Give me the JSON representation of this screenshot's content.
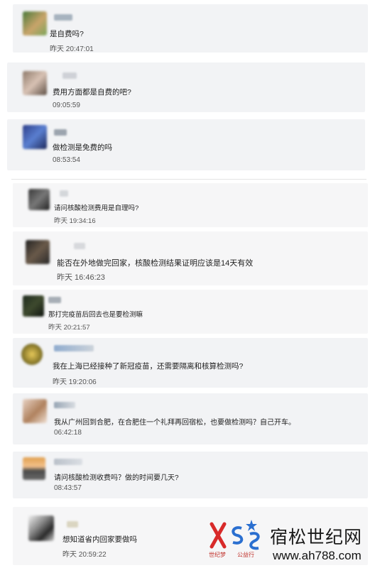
{
  "comments": [
    {
      "message": "是自费吗?",
      "time": "昨天 20:47:01"
    },
    {
      "message": "费用方面都是自费的吧?",
      "time": "09:05:59"
    },
    {
      "message": "做检测是免费的吗",
      "time": "08:53:54"
    },
    {
      "message": "请问核酸检测费用是自理吗?",
      "time": "昨天 19:34:16"
    },
    {
      "message": "能否在外地做完回家，核酸检测结果证明应该是14天有效",
      "time": "昨天 16:46:23"
    },
    {
      "message": "那打完疫苗后回去也是要检测嘛",
      "time": "昨天 20:21:57"
    },
    {
      "message": "我在上海已经接种了新冠疫苗，还需要隔离和核算检测吗?",
      "time": "昨天 19:20:06"
    },
    {
      "message": "我从广州回到合肥，在合肥住一个礼拜再回宿松，也要做检测吗？自己开车。",
      "time": "06:42:18"
    },
    {
      "message": "请问核酸检测收费吗？做的时间要几天?",
      "time": "08:43:57"
    },
    {
      "message": "想知道省内回家要做吗",
      "time": "昨天 20:59:22"
    }
  ],
  "watermark": {
    "site_name": "宿松世纪网",
    "url": "www.ah788.com",
    "logo_letters": "XSS",
    "logo_caption_left": "世纪梦",
    "logo_caption_right": "公益行"
  }
}
